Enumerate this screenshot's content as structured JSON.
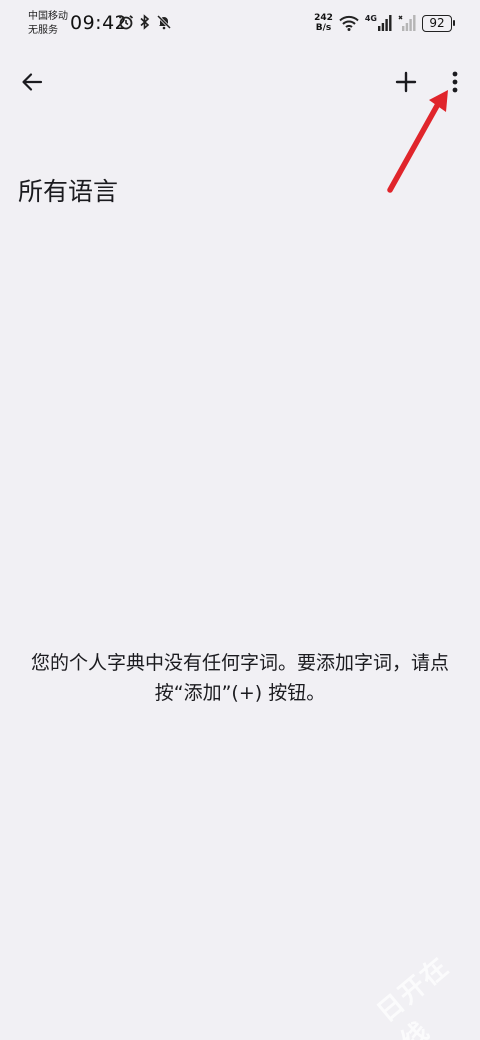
{
  "status_bar": {
    "carrier_line1": "中国移动",
    "carrier_line2": "无服务",
    "time": "09:42",
    "net_speed_value": "242",
    "net_speed_unit": "B/s",
    "signal_label": "4G",
    "battery": "92",
    "icons": [
      "alarm-icon",
      "bluetooth-icon",
      "mute-icon",
      "wifi-icon",
      "signal-icon",
      "no-signal-icon",
      "battery-icon"
    ]
  },
  "app_bar": {
    "back_icon": "arrow-left-icon",
    "add_icon": "plus-icon",
    "more_icon": "more-vert-icon"
  },
  "title": "所有语言",
  "empty_message": "您的个人字典中没有任何字词。要添加字词，请点按“添加”(+) 按钮。",
  "watermark": "日开在线",
  "colors": {
    "background": "#f1f0f4",
    "text": "#1b1b1f",
    "annotation": "#e0252b"
  }
}
